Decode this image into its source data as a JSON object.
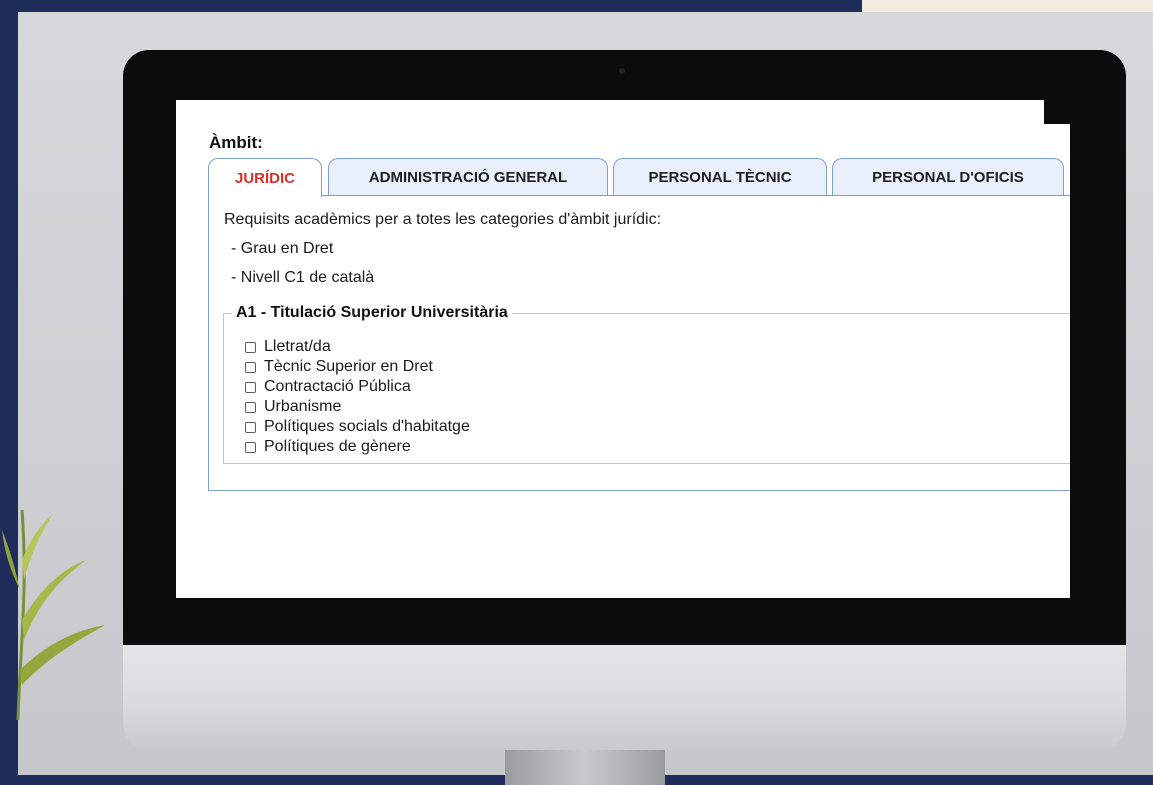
{
  "ambit": {
    "label": "Àmbit:",
    "tabs": [
      {
        "label": "JURÍDIC",
        "active": true
      },
      {
        "label": "ADMINISTRACIÓ GENERAL",
        "active": false
      },
      {
        "label": "PERSONAL TÈCNIC",
        "active": false
      },
      {
        "label": "PERSONAL D'OFICIS",
        "active": false
      }
    ],
    "active_tab_color": "#d8302b",
    "tab_border_color": "#7d9ed7"
  },
  "panel": {
    "intro": "Requisits acadèmics per a totes les categories d'àmbit jurídic:",
    "requirements": [
      "- Grau en Dret",
      "- Nivell C1 de català"
    ],
    "group": {
      "legend": "A1 - Titulació Superior Universitària",
      "options": [
        {
          "label": "Lletrat/da",
          "checked": false
        },
        {
          "label": "Tècnic Superior en Dret",
          "checked": false
        },
        {
          "label": "Contractació Pública",
          "checked": false
        },
        {
          "label": "Urbanisme",
          "checked": false
        },
        {
          "label": "Polítiques socials d'habitatge",
          "checked": false
        },
        {
          "label": "Polítiques de gènere",
          "checked": false
        }
      ]
    }
  }
}
